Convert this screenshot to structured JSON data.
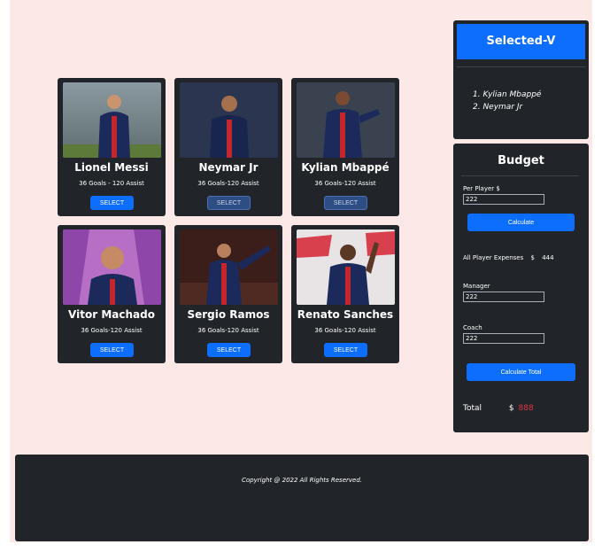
{
  "players": [
    {
      "name": "Lionel Messi",
      "stats": "36 Goals - 120 Assist",
      "button": "SELECT",
      "disabled": false
    },
    {
      "name": "Neymar Jr",
      "stats": "36 Goals-120 Assist",
      "button": "SELECT",
      "disabled": true
    },
    {
      "name": "Kylian Mbappé",
      "stats": "36 Goals-120 Assist",
      "button": "SELECT",
      "disabled": true
    },
    {
      "name": "Vitor Machado",
      "stats": "36 Goals-120 Assist",
      "button": "SELECT",
      "disabled": false
    },
    {
      "name": "Sergio Ramos",
      "stats": "36 Goals-120 Assist",
      "button": "SELECT",
      "disabled": false
    },
    {
      "name": "Renato Sanches",
      "stats": "36 Goals-120 Assist",
      "button": "SELECT",
      "disabled": false
    }
  ],
  "selected": {
    "title": "Selected-V",
    "items": [
      "1. Kylian Mbappé",
      "2. Neymar Jr"
    ]
  },
  "budget": {
    "title": "Budget",
    "per_player_label": "Per Player $",
    "per_player_value": "222",
    "calculate_label": "Calculate",
    "expenses_label": "All Player Expenses",
    "expenses_currency": "$",
    "expenses_value": "444",
    "manager_label": "Manager",
    "manager_value": "222",
    "coach_label": "Coach",
    "coach_value": "222",
    "calculate_total_label": "Calculate Total",
    "total_label": "Total",
    "total_currency": "$",
    "total_value": "888"
  },
  "footer": {
    "copyright": "Copyright @ 2022 All Rights Reserved."
  },
  "colors": {
    "page_bg": "#fde8e8",
    "panel_bg": "#212529",
    "accent": "#0d6efd",
    "total_value": "#dc3545"
  }
}
